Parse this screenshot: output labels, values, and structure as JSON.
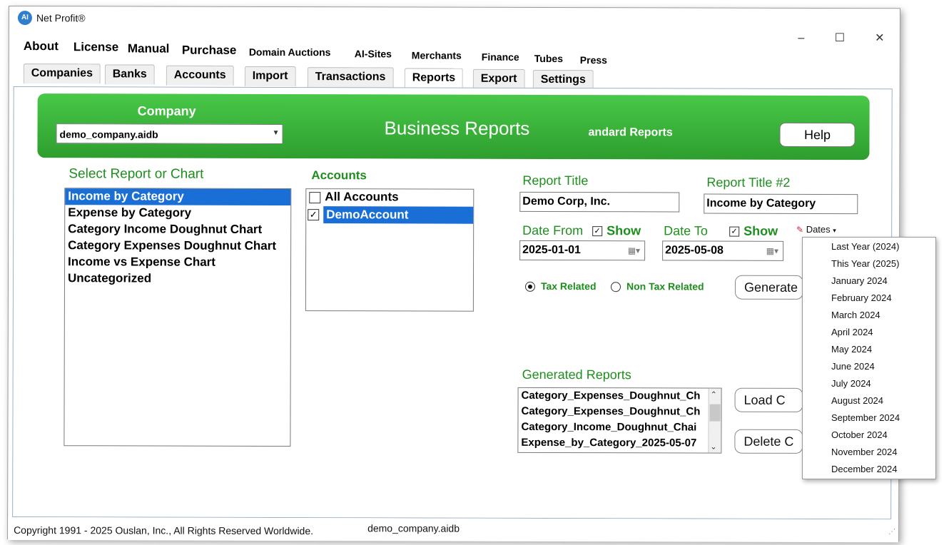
{
  "app": {
    "title": "Net Profit®",
    "logo_text": "AI"
  },
  "window_controls": {
    "minimize": "–",
    "maximize": "☐",
    "close": "✕"
  },
  "menu": [
    "About",
    "License",
    "Manual",
    "Purchase",
    "Domain Auctions",
    "AI-Sites",
    "Merchants",
    "Finance",
    "Tubes",
    "Press"
  ],
  "tabs": [
    {
      "label": "Companies",
      "active": false
    },
    {
      "label": "Banks",
      "active": false
    },
    {
      "label": "Accounts",
      "active": false
    },
    {
      "label": "Import",
      "active": false
    },
    {
      "label": "Transactions",
      "active": false
    },
    {
      "label": "Reports",
      "active": true
    },
    {
      "label": "Export",
      "active": false
    },
    {
      "label": "Settings",
      "active": false
    }
  ],
  "header": {
    "company_label": "Company",
    "company_value": "demo_company.aidb",
    "title": "Business Reports",
    "subtitle": "andard Reports",
    "help_label": "Help"
  },
  "reports": {
    "label": "Select Report or Chart",
    "items": [
      "Income by Category",
      "Expense by Category",
      "Category Income Doughnut Chart",
      "Category Expenses Doughnut Chart",
      "Income vs Expense Chart",
      "Uncategorized"
    ],
    "selected_index": 0
  },
  "accounts": {
    "label": "Accounts",
    "items": [
      {
        "label": "All Accounts",
        "checked": false,
        "selected": false
      },
      {
        "label": "DemoAccount",
        "checked": true,
        "selected": true
      }
    ]
  },
  "report_title": {
    "label": "Report Title",
    "value": "Demo Corp, Inc."
  },
  "report_title2": {
    "label": "Report Title #2",
    "value": "Income by Category"
  },
  "date_from": {
    "label": "Date From",
    "show_label": "Show",
    "show_checked": true,
    "value": "2025-01-01"
  },
  "date_to": {
    "label": "Date To",
    "show_label": "Show",
    "show_checked": true,
    "value": "2025-05-08"
  },
  "dates_button": {
    "label": "Dates"
  },
  "dates_menu": [
    "Last Year (2024)",
    "This Year (2025)",
    "January 2024",
    "February 2024",
    "March 2024",
    "April 2024",
    "May 2024",
    "June 2024",
    "July 2024",
    "August 2024",
    "September 2024",
    "October 2024",
    "November 2024",
    "December 2024"
  ],
  "tax": {
    "tax_related": "Tax Related",
    "non_tax_related": "Non Tax Related",
    "selected": "tax_related"
  },
  "generate_label": "Generate",
  "generated": {
    "label": "Generated Reports",
    "items": [
      "Category_Expenses_Doughnut_Ch",
      "Category_Expenses_Doughnut_Ch",
      "Category_Income_Doughnut_Chai",
      "Expense_by_Category_2025-05-07"
    ]
  },
  "load_label": "Load C",
  "delete_label": "Delete C",
  "status": {
    "copyright": "Copyright 1991 - 2025 Ouslan, Inc., All Rights Reserved Worldwide.",
    "file": "demo_company.aidb"
  }
}
